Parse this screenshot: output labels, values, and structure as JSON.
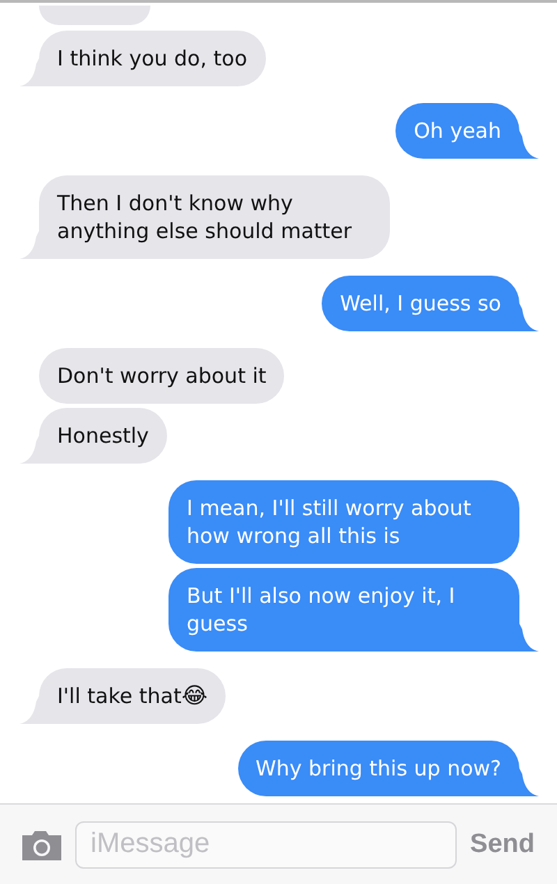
{
  "messages": [
    {
      "kind": "received",
      "text": "I think you do, too",
      "tail": true
    },
    {
      "kind": "sent",
      "text": "Oh yeah",
      "tail": true
    },
    {
      "kind": "received",
      "text": "Then I don't know why anything else should matter",
      "tail": true
    },
    {
      "kind": "sent",
      "text": "Well, I guess so",
      "tail": true
    },
    {
      "kind": "received",
      "text": "Don't worry about it",
      "tail": false
    },
    {
      "kind": "received",
      "text": "Honestly",
      "tail": true
    },
    {
      "kind": "sent",
      "text": "I mean, I'll still worry about how wrong all this is",
      "tail": false
    },
    {
      "kind": "sent",
      "text": "But I'll also now enjoy it, I guess",
      "tail": true
    },
    {
      "kind": "received",
      "text": "I'll take that",
      "tail": true,
      "emoji": "😂"
    },
    {
      "kind": "sent",
      "text": "Why bring this up now?",
      "tail": true
    }
  ],
  "composer": {
    "placeholder": "iMessage",
    "send": "Send"
  }
}
